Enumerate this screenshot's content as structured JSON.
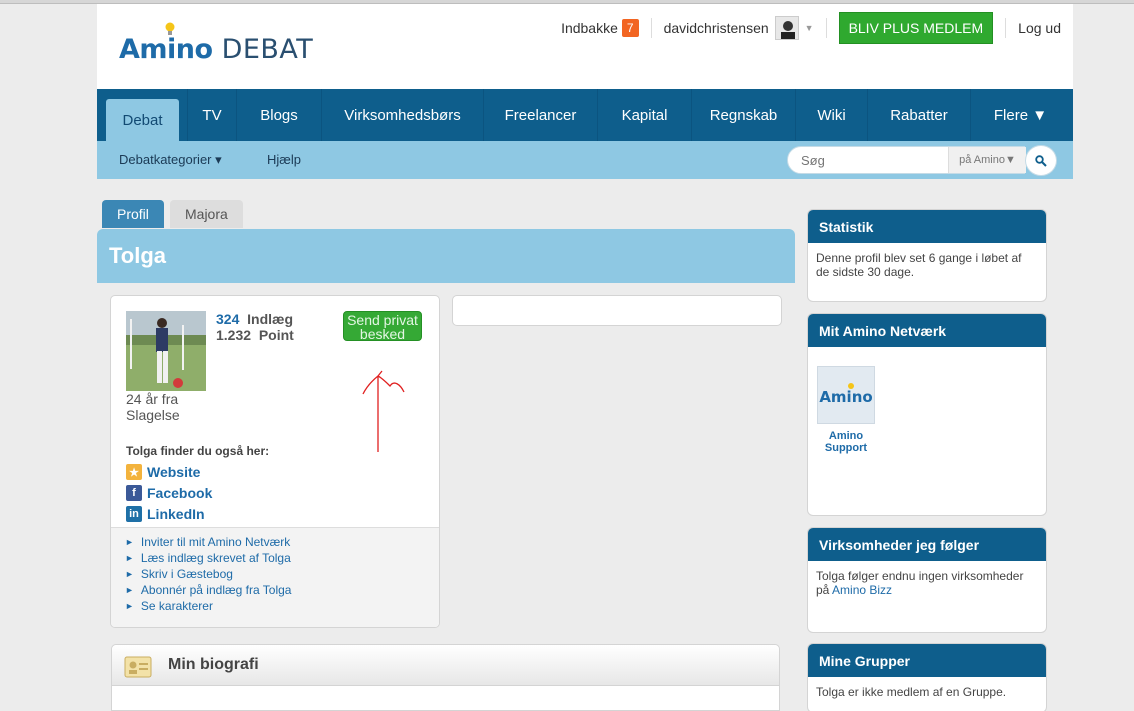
{
  "header": {
    "logo_word1": "Amino",
    "logo_word2": "DEBAT",
    "inbox_label": "Indbakke",
    "inbox_count": "7",
    "username": "davidchristensen",
    "plus_button": "BLIV PLUS MEDLEM",
    "logout": "Log ud"
  },
  "nav": {
    "items": [
      "Debat",
      "TV",
      "Blogs",
      "Virksomhedsbørs",
      "Freelancer",
      "Kapital",
      "Regnskab",
      "Wiki",
      "Rabatter",
      "Flere ▼"
    ],
    "active": "Debat"
  },
  "subnav": {
    "categories": "Debatkategorier ▾",
    "help": "Hjælp",
    "search_placeholder": "Søg",
    "search_scope": "på Amino▼"
  },
  "tabs": {
    "profile": "Profil",
    "other": "Majora"
  },
  "profile": {
    "name": "Tolga",
    "posts_count": "324",
    "posts_label": "Indlæg",
    "points_count": "1.232",
    "points_label": "Point",
    "location_line1": "24 år fra",
    "location_line2": "Slagelse",
    "pm_button": "Send privat besked",
    "find_title": "Tolga finder du også her:",
    "social": [
      "Website",
      "Facebook",
      "LinkedIn"
    ],
    "actions": [
      "Inviter til mit Amino Netværk",
      "Læs indlæg skrevet af Tolga",
      "Skriv i Gæstebog",
      "Abonnér på indlæg fra Tolga",
      "Se karakterer"
    ]
  },
  "bio": {
    "title": "Min biografi"
  },
  "sidebar": {
    "statistik": {
      "title": "Statistik",
      "text": "Denne profil blev set 6 gange i løbet af de sidste 30 dage."
    },
    "network": {
      "title": "Mit Amino Netværk",
      "tile_logo": "Amino",
      "member_name": "Amino Support"
    },
    "companies": {
      "title": "Virksomheder jeg følger",
      "text": "Tolga følger endnu ingen virksomheder på",
      "link": "Amino Bizz"
    },
    "groups": {
      "title": "Mine Grupper",
      "text": "Tolga er ikke medlem af en Gruppe."
    }
  },
  "colors": {
    "nav_blue": "#0e5e8c",
    "light_blue": "#8ec8e3",
    "link_blue": "#1e6ba8",
    "green_button": "#2fa92f",
    "badge_orange": "#f26522",
    "annotation_red": "#e02020"
  }
}
